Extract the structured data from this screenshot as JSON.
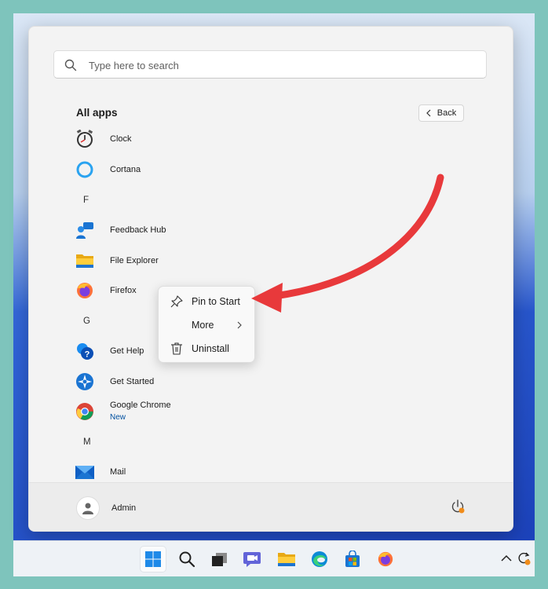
{
  "search": {
    "placeholder": "Type here to search"
  },
  "all_apps": {
    "title": "All apps",
    "back_label": "Back"
  },
  "apps": [
    {
      "name": "Clock"
    },
    {
      "name": "Cortana"
    },
    {
      "letter": "F"
    },
    {
      "name": "Feedback Hub"
    },
    {
      "name": "File Explorer"
    },
    {
      "name": "Firefox"
    },
    {
      "letter": "G"
    },
    {
      "name": "Get Help"
    },
    {
      "name": "Get Started"
    },
    {
      "name": "Google Chrome",
      "badge": "New"
    },
    {
      "letter": "M"
    },
    {
      "name": "Mail"
    }
  ],
  "context_menu": {
    "items": [
      {
        "label": "Pin to Start",
        "icon": "pin-icon"
      },
      {
        "label": "More",
        "icon": "chevron-right-icon"
      },
      {
        "label": "Uninstall",
        "icon": "trash-icon"
      }
    ]
  },
  "footer": {
    "user_name": "Admin"
  },
  "taskbar": {
    "icons": [
      "windows-start-icon",
      "search-icon",
      "task-view-icon",
      "teams-chat-icon",
      "file-explorer-icon",
      "edge-icon",
      "store-icon",
      "firefox-icon"
    ]
  },
  "colors": {
    "accent": "#0067c0",
    "arrow": "#e8393b",
    "new_badge": "#0050a0"
  }
}
